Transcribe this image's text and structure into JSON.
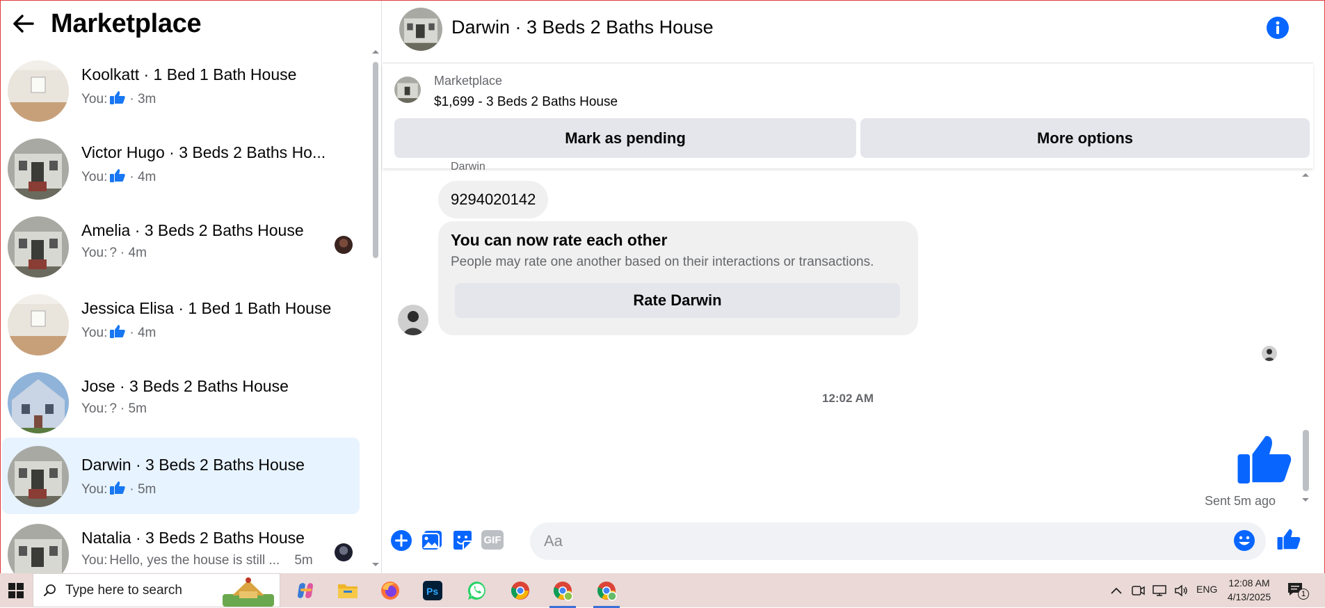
{
  "left_panel": {
    "title": "Marketplace",
    "conversations": [
      {
        "name": "Koolkatt · 1 Bed 1 Bath House",
        "prefix": "You:",
        "like": true,
        "text": "",
        "time": "· 3m",
        "active": false
      },
      {
        "name": "Victor Hugo · 3 Beds 2 Baths Ho...",
        "prefix": "You:",
        "like": true,
        "text": "",
        "time": "· 4m",
        "active": false
      },
      {
        "name": "Amelia · 3 Beds 2 Baths House",
        "prefix": "You:",
        "like": false,
        "text": "?",
        "time": "· 4m",
        "active": false
      },
      {
        "name": "Jessica Elisa · 1 Bed 1 Bath House",
        "prefix": "You:",
        "like": true,
        "text": "",
        "time": "· 4m",
        "active": false
      },
      {
        "name": "Jose · 3 Beds 2 Baths House",
        "prefix": "You:",
        "like": false,
        "text": "?",
        "time": "· 5m",
        "active": false
      },
      {
        "name": "Darwin · 3 Beds 2 Baths House",
        "prefix": "You:",
        "like": true,
        "text": "",
        "time": "· 5m",
        "active": true
      },
      {
        "name": "Natalia · 3 Beds 2 Baths House",
        "prefix": "You:",
        "like": false,
        "text": "Hello, yes the house is still ...",
        "time": "5m",
        "active": false
      }
    ]
  },
  "chat": {
    "title": "Darwin · 3 Beds 2 Baths House",
    "listing": {
      "label": "Marketplace",
      "price_title": "$1,699 - 3 Beds 2 Baths House",
      "pending_button": "Mark as pending",
      "more_button": "More options"
    },
    "messages": {
      "sender_name": "Darwin",
      "phone": "9294020142",
      "rate_title": "You can now rate each other",
      "rate_desc": "People may rate one another based on their interactions or transactions.",
      "rate_button": "Rate Darwin",
      "timestamp": "12:02 AM",
      "sent_status": "Sent 5m ago"
    },
    "composer": {
      "placeholder": "Aa",
      "gif_label": "GIF"
    }
  },
  "taskbar": {
    "search_placeholder": "Type here to search",
    "language": "ENG",
    "time": "12:08 AM",
    "date": "4/13/2025",
    "notification_count": "1"
  },
  "colors": {
    "accent": "#0866ff",
    "active_row": "#e7f3ff",
    "bubble": "#f0f0f0",
    "taskbar": "#ead9d6"
  }
}
